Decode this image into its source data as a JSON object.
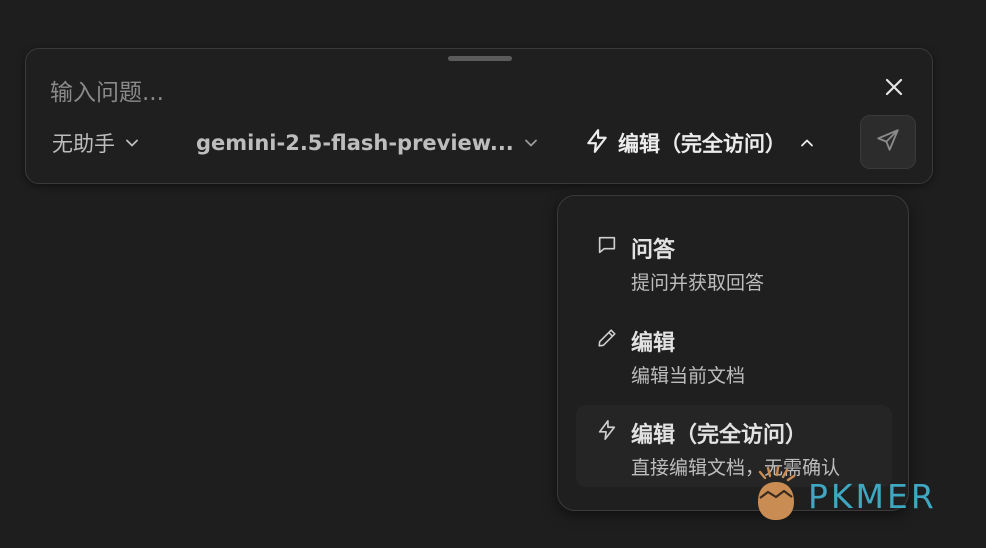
{
  "input": {
    "placeholder": "输入问题..."
  },
  "toolbar": {
    "assistant_label": "无助手",
    "model_label": "gemini-2.5-flash-preview...",
    "mode_label": "编辑（完全访问）"
  },
  "mode_menu": {
    "items": [
      {
        "title": "问答",
        "description": "提问并获取回答",
        "icon": "chat-bubble-icon"
      },
      {
        "title": "编辑",
        "description": "编辑当前文档",
        "icon": "pencil-icon"
      },
      {
        "title": "编辑（完全访问）",
        "description": "直接编辑文档，无需确认",
        "icon": "lightning-icon",
        "selected": true
      }
    ]
  },
  "watermark": {
    "text": "PKMER"
  },
  "colors": {
    "background": "#1e1e1e",
    "panel": "#1f1f1f",
    "border": "#3a3a3a",
    "watermark_teal": "#3ea7c2",
    "watermark_orange": "#c98c52"
  }
}
